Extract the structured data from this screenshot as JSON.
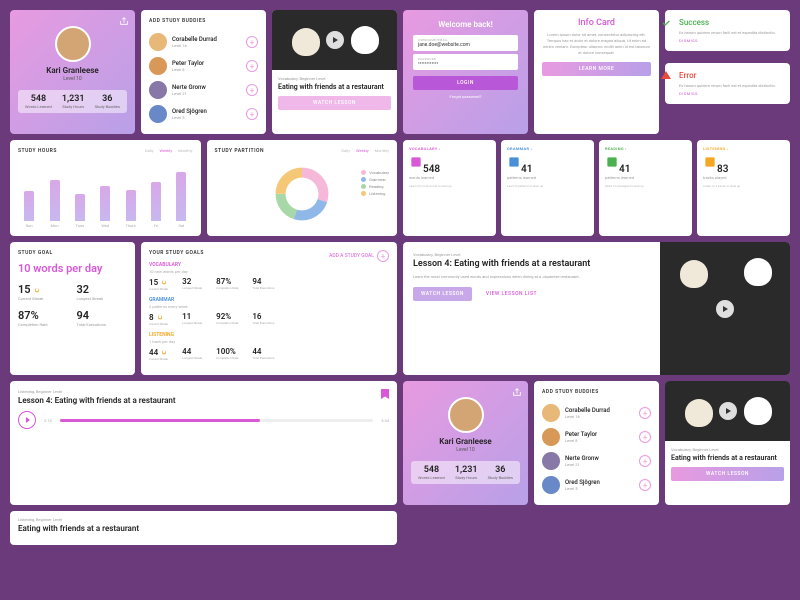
{
  "profile": {
    "name": "Kari Granleese",
    "level": "Level 10",
    "stats": [
      {
        "n": "548",
        "l": "Words Learned"
      },
      {
        "n": "1,231",
        "l": "Study Hours"
      },
      {
        "n": "36",
        "l": "Study Buddies"
      }
    ]
  },
  "buddies": {
    "title": "ADD STUDY BUDDIES",
    "items": [
      {
        "name": "Corabelle Durrad",
        "lvl": "Level 16"
      },
      {
        "name": "Peter Taylor",
        "lvl": "Level 8"
      },
      {
        "name": "Nerte Gronw",
        "lvl": "Level 21"
      },
      {
        "name": "Ored Sjögren",
        "lvl": "Level 5"
      }
    ]
  },
  "lesson_small": {
    "cat": "Vocabulary, Beginner Level",
    "title": "Eating with friends at a restaurant",
    "btn": "WATCH LESSON"
  },
  "welcome": {
    "title": "Welcome back!",
    "user_lbl": "USERNAME/EMAIL",
    "user_val": "jane.doe@website.com",
    "pass_lbl": "PASSWORD",
    "pass_val": "••••••••••••",
    "login": "LOGIN",
    "forgot": "Forgot password?"
  },
  "info": {
    "title": "Info Card",
    "text": "Lorem ipsum dolor sit amet, consectetur adipiscing elit. Tempus hac et dolor et dolore magna aliqua. Ut enim ad minim veniam. Excepteur ullamco mollit anim id est laborum et dolore consequat.",
    "btn": "LEARN MORE"
  },
  "success": {
    "title": "Success",
    "text": "Es harum quidem rerum facil est et expedita distinctio.",
    "dismiss": "DISMISS"
  },
  "error": {
    "title": "Error",
    "text": "Es harum quidem rerum facil est et expedita distinctio.",
    "dismiss": "DISMISS"
  },
  "chart_data": [
    {
      "type": "bar",
      "title": "STUDY HOURS",
      "categories": [
        "Sun",
        "Mon",
        "Tues",
        "Wed",
        "Thurs",
        "Fri",
        "Sat"
      ],
      "values": [
        38,
        52,
        35,
        44,
        40,
        50,
        62
      ],
      "ylim": [
        0,
        70
      ],
      "tabs": [
        "Daily",
        "Weekly",
        "Monthly"
      ],
      "active_tab": "Weekly"
    },
    {
      "type": "pie",
      "title": "STUDY PARTITION",
      "series": [
        {
          "name": "Vocabulary",
          "value": 30,
          "color": "#f5b8d8"
        },
        {
          "name": "Grammar",
          "value": 25,
          "color": "#8fb8e8"
        },
        {
          "name": "Reading",
          "value": 20,
          "color": "#a8d8a8"
        },
        {
          "name": "Listening",
          "value": 25,
          "color": "#f5c878"
        }
      ],
      "tabs": [
        "Daily",
        "Weekly",
        "Monthly"
      ],
      "active_tab": "Weekly"
    }
  ],
  "mini": [
    {
      "title": "VOCABULARY ›",
      "num": "548",
      "sub": "words learned",
      "foot": "Learn 32 more words to level up"
    },
    {
      "title": "GRAMMAR ›",
      "num": "41",
      "sub": "patterns learned",
      "foot": "Learn 8 patterns to level up"
    },
    {
      "title": "READING ›",
      "num": "41",
      "sub": "patterns learned",
      "foot": "Read 12 passages to level up"
    },
    {
      "title": "LISTENING ›",
      "num": "83",
      "sub": "tracks played",
      "foot": "Listen to 4 tracks to level up"
    }
  ],
  "big_lesson": {
    "cat": "Vocabulary, Beginner Level",
    "title": "Lesson 4: Eating with friends at a restaurant",
    "desc": "Learn the most commonly used words and expressions when dining at a Japanese restaurant.",
    "watch": "WATCH LESSON",
    "list": "VIEW LESSON LIST"
  },
  "goal": {
    "title": "STUDY GOAL",
    "main": "10 words per day",
    "stats": [
      {
        "n": "15",
        "l": "Current Streak",
        "flame": true
      },
      {
        "n": "32",
        "l": "Longest Streak"
      },
      {
        "n": "87%",
        "l": "Completion Rate"
      },
      {
        "n": "94",
        "l": "Total Executions"
      }
    ]
  },
  "goals_table": {
    "title": "YOUR STUDY GOALS",
    "add": "ADD A STUDY GOAL",
    "rows": [
      {
        "title": "VOCABULARY",
        "color": "#d858d8",
        "sub": "10 new words per day",
        "s": [
          {
            "n": "15",
            "f": true,
            "l": "Current Streak"
          },
          {
            "n": "32",
            "l": "Longest Streak"
          },
          {
            "n": "87%",
            "l": "Completion Rate"
          },
          {
            "n": "94",
            "l": "Total Executions"
          }
        ]
      },
      {
        "title": "GRAMMAR",
        "color": "#4a90d8",
        "sub": "2 patterns every week",
        "s": [
          {
            "n": "8",
            "f": true,
            "l": "Current Streak"
          },
          {
            "n": "11",
            "l": "Longest Streak"
          },
          {
            "n": "92%",
            "l": "Completion Rate"
          },
          {
            "n": "16",
            "l": "Total Executions"
          }
        ]
      },
      {
        "title": "LISTENING",
        "color": "#f5a623",
        "sub": "1 track per day",
        "s": [
          {
            "n": "44",
            "f": true,
            "l": "Current Streak"
          },
          {
            "n": "44",
            "l": "Longest Streak"
          },
          {
            "n": "100%",
            "l": "Completion Rate"
          },
          {
            "n": "44",
            "l": "Total Executions"
          }
        ]
      }
    ]
  },
  "player": {
    "cat": "Listening, Beginner Level",
    "title": "Lesson 4: Eating with friends at a restaurant",
    "cur": "2:14",
    "dur": "3:34",
    "pct": 64
  },
  "bottom": {
    "cat": "Listening, Beginner Level",
    "title": "Eating with friends at a restaurant"
  },
  "lesson_small2": {
    "cat": "Vocabulary, Beginner Level",
    "title": "Eating with friends at a restaurant",
    "btn": "WATCH LESSON"
  }
}
